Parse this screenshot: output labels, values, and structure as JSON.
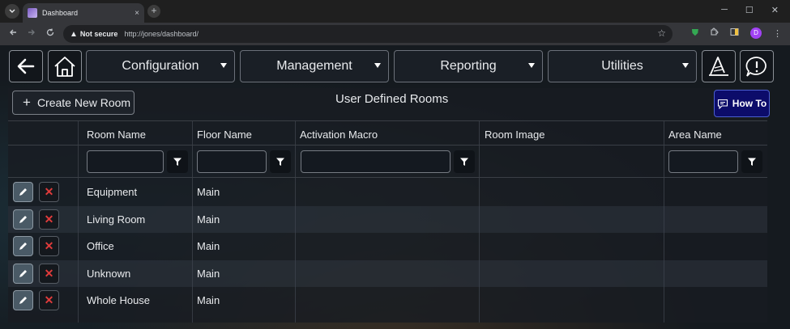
{
  "browser": {
    "tab_title": "Dashboard",
    "tab_close": "×",
    "new_tab": "+",
    "security_label": "Not secure",
    "url": "http://jones/dashboard/",
    "profile_initial": "D",
    "window_controls": [
      "─",
      "☐",
      "✕"
    ]
  },
  "nav": {
    "back_icon": "back-arrow-icon",
    "home_icon": "home-icon",
    "menus": [
      "Configuration",
      "Management",
      "Reporting",
      "Utilities"
    ],
    "wizard_icon": "wizard-hat-icon",
    "feedback_icon": "chat-alert-icon"
  },
  "panel": {
    "create_label": "Create New Room",
    "title": "User Defined Rooms",
    "howto_label": "How To"
  },
  "table": {
    "columns": [
      "Room Name",
      "Floor Name",
      "Activation Macro",
      "Room Image",
      "Area Name"
    ],
    "rows": [
      {
        "room": "Equipment",
        "floor": "Main"
      },
      {
        "room": "Living Room",
        "floor": "Main"
      },
      {
        "room": "Office",
        "floor": "Main"
      },
      {
        "room": "Unknown",
        "floor": "Main"
      },
      {
        "room": "Whole House",
        "floor": "Main"
      }
    ],
    "delete_glyph": "✕"
  },
  "colors": {
    "howto_bg": "#0c0c6a",
    "delete_red": "#e03b3b",
    "secure_shield": "#34a853"
  }
}
